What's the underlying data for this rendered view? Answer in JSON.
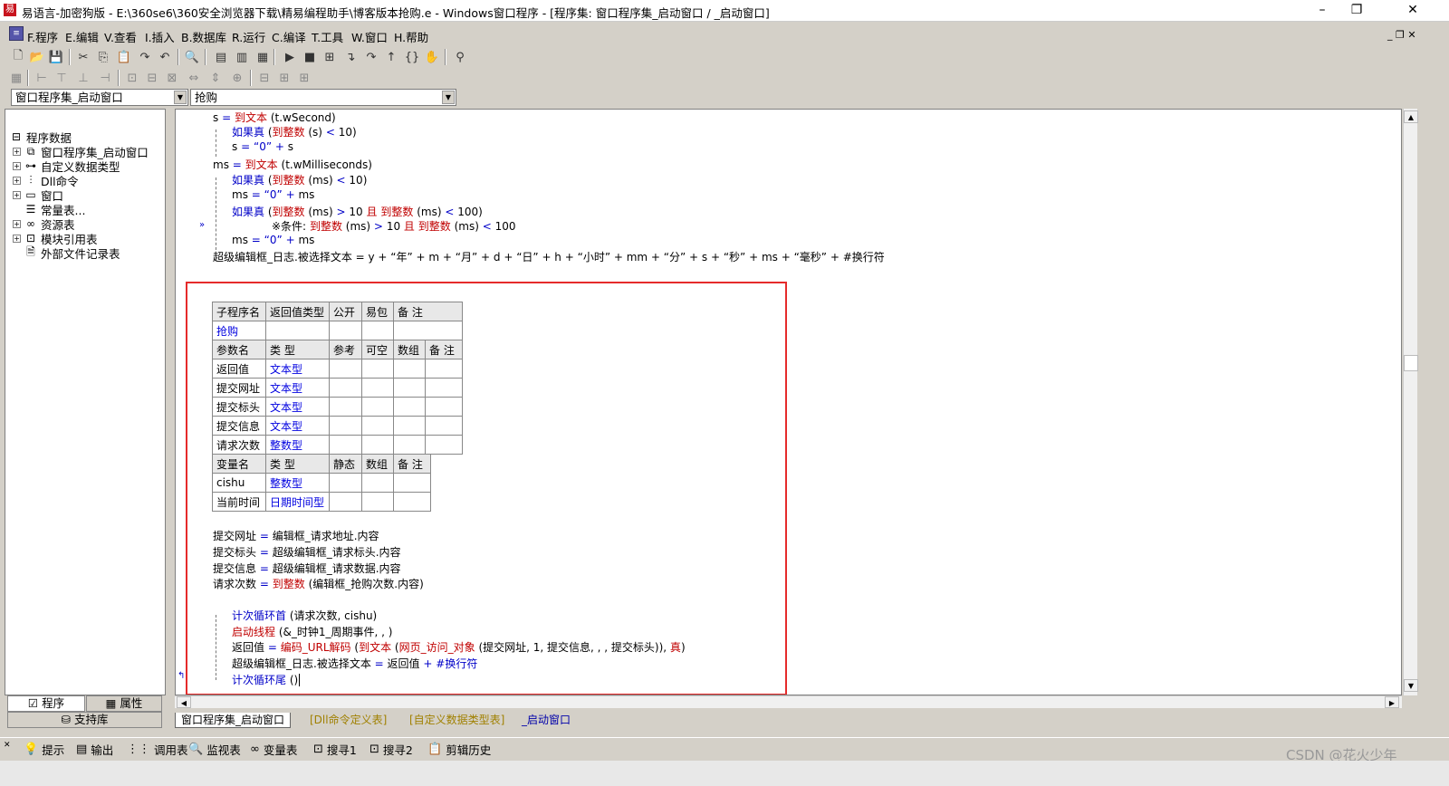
{
  "window": {
    "title": "易语言-加密狗版 - E:\\360se6\\360安全浏览器下载\\精易编程助手\\博客版本抢购.e - Windows窗口程序 - [程序集: 窗口程序集_启动窗口 / _启动窗口]"
  },
  "menu": [
    "F.程序",
    "E.编辑",
    "V.查看",
    "I.插入",
    "B.数据库",
    "R.运行",
    "C.编译",
    "T.工具",
    "W.窗口",
    "H.帮助"
  ],
  "selectors": {
    "left": "窗口程序集_启动窗口",
    "right": "抢购"
  },
  "tree": {
    "root": "程序数据",
    "items": [
      "窗口程序集_启动窗口",
      "自定义数据类型",
      "Dll命令",
      "窗口",
      "常量表...",
      "资源表",
      "模块引用表",
      "外部文件记录表"
    ]
  },
  "left_tabs": {
    "program": "程序",
    "property": "属性",
    "support": "支持库"
  },
  "code_top": {
    "l1": [
      "s",
      "=",
      "到文本",
      "(t.wSecond)"
    ],
    "l2": [
      "如果真",
      "(",
      "到整数",
      "(s)",
      "<",
      "10",
      ")"
    ],
    "l3": [
      "s",
      "=",
      "“0”",
      "+",
      "s"
    ],
    "l4": [
      "ms",
      "=",
      "到文本",
      "(t.wMilliseconds)"
    ],
    "l5": [
      "如果真",
      "(",
      "到整数",
      "(ms)",
      "<",
      "10",
      ")"
    ],
    "l6": [
      "ms",
      "=",
      "“0”",
      "+",
      "ms"
    ],
    "l7": [
      "如果真",
      "(",
      "到整数",
      "(ms)",
      ">",
      "10",
      "且",
      "到整数",
      "(ms)",
      "<",
      "100",
      ")"
    ],
    "l8": [
      "※条件:",
      "到整数",
      "(ms)",
      ">",
      "10",
      "且",
      "到整数",
      "(ms)",
      "<",
      "100"
    ],
    "l9": [
      "ms",
      "=",
      "“0”",
      "+",
      "ms"
    ],
    "l10": "超级编辑框_日志.被选择文本 = y + “年” + m + “月” + d + “日” + h + “小时” + mm + “分” + s + “秒” + ms + “毫秒” + #换行符"
  },
  "sub_table": {
    "headers": [
      "子程序名",
      "返回值类型",
      "公开",
      "易包",
      "备 注"
    ],
    "name": "抢购",
    "param_headers": [
      "参数名",
      "类 型",
      "参考",
      "可空",
      "数组",
      "备 注"
    ],
    "params": [
      {
        "name": "返回值",
        "type": "文本型"
      },
      {
        "name": "提交网址",
        "type": "文本型"
      },
      {
        "name": "提交标头",
        "type": "文本型"
      },
      {
        "name": "提交信息",
        "type": "文本型"
      },
      {
        "name": "请求次数",
        "type": "整数型"
      }
    ]
  },
  "var_table": {
    "headers": [
      "变量名",
      "类 型",
      "静态",
      "数组",
      "备 注"
    ],
    "vars": [
      {
        "name": "cishu",
        "type": "整数型"
      },
      {
        "name": "当前时间",
        "type": "日期时间型"
      }
    ]
  },
  "code_body": {
    "a1": [
      "提交网址",
      "=",
      "编辑框_请求地址.内容"
    ],
    "a2": [
      "提交标头",
      "=",
      "超级编辑框_请求标头.内容"
    ],
    "a3": [
      "提交信息",
      "=",
      "超级编辑框_请求数据.内容"
    ],
    "a4": [
      "请求次数",
      "=",
      "到整数",
      "(编辑框_抢购次数.内容)"
    ],
    "loop_head": [
      "计次循环首",
      "(请求次数, cishu)"
    ],
    "b1": [
      "启动线程",
      "(&_时钟1_周期事件, , )"
    ],
    "b2": [
      "返回值",
      "=",
      "编码_URL解码",
      "(",
      "到文本",
      "(",
      "网页_访问_对象",
      "(提交网址, 1, 提交信息, , , 提交标头)",
      "),",
      "真",
      ")"
    ],
    "b3": [
      "超级编辑框_日志.被选择文本",
      "=",
      "返回值",
      "+",
      "#换行符"
    ],
    "loop_tail": [
      "计次循环尾",
      "()"
    ]
  },
  "bottom_tabs": [
    "窗口程序集_启动窗口",
    "[Dll命令定义表]",
    "[自定义数据类型表]",
    "_启动窗口"
  ],
  "status": [
    "提示",
    "输出",
    "调用表",
    "监视表",
    "变量表",
    "搜寻1",
    "搜寻2",
    "剪辑历史"
  ],
  "watermark": "CSDN @花火少年",
  "colors": {
    "highlight_box": "#e52b2b",
    "keyword": "#0000c8",
    "function": "#c00000"
  }
}
